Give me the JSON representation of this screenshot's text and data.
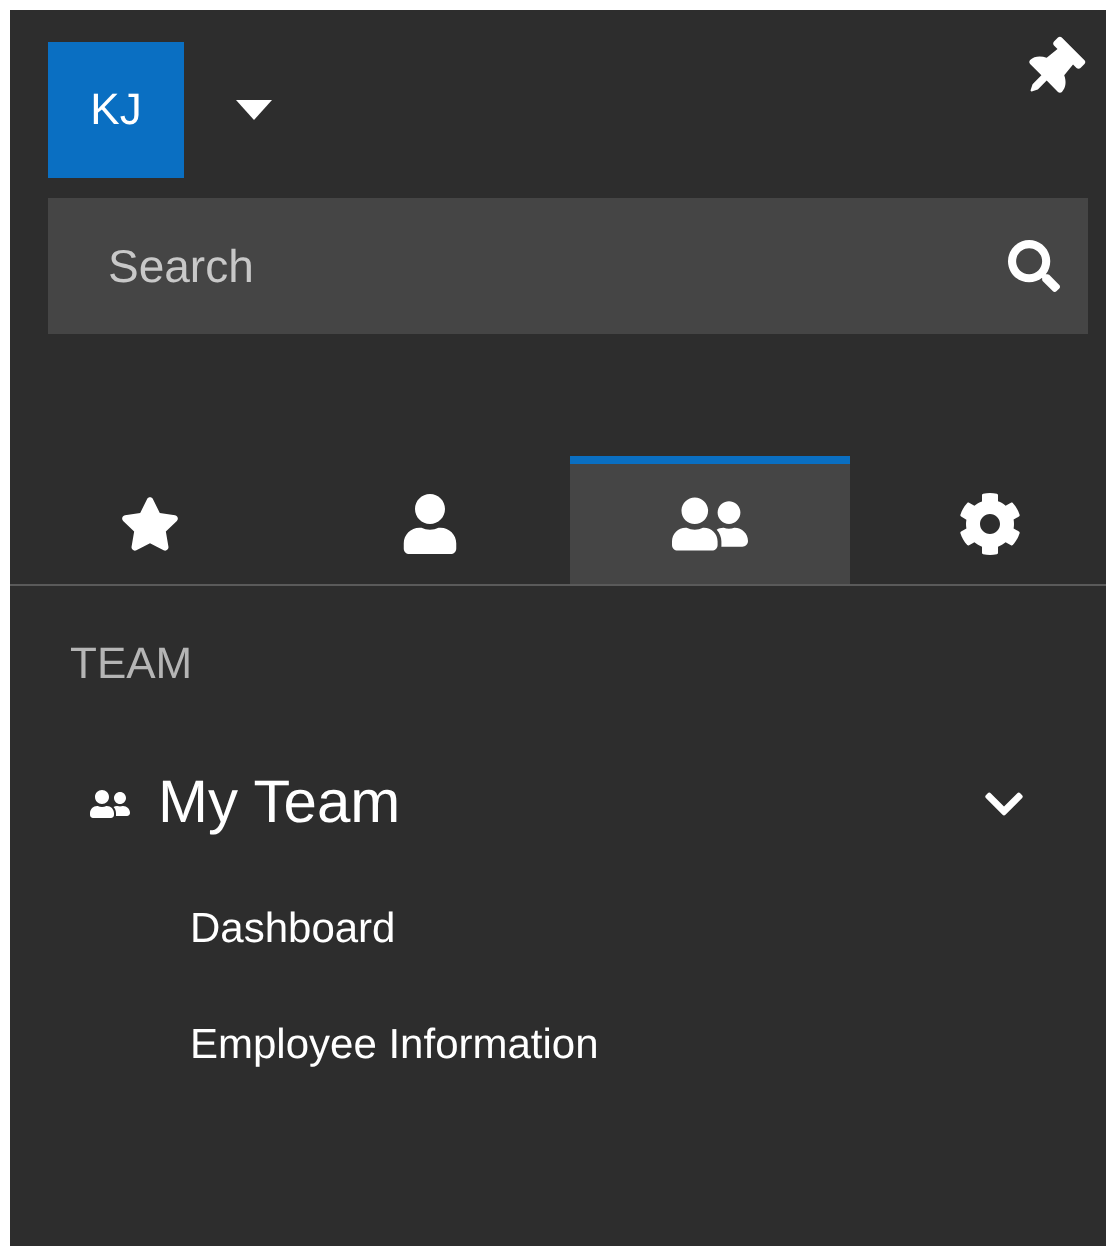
{
  "user": {
    "initials": "KJ"
  },
  "search": {
    "placeholder": "Search"
  },
  "tabs": [
    {
      "kind": "favorites",
      "selected": false
    },
    {
      "kind": "profile",
      "selected": false
    },
    {
      "kind": "team",
      "selected": true
    },
    {
      "kind": "settings",
      "selected": false
    }
  ],
  "section": {
    "title": "TEAM"
  },
  "nav": [
    {
      "label": "My Team",
      "expanded": true,
      "children": [
        {
          "label": "Dashboard"
        },
        {
          "label": "Employee Information"
        }
      ]
    }
  ]
}
